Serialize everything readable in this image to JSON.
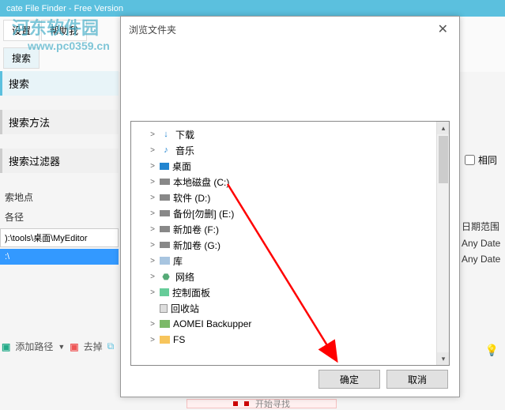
{
  "app": {
    "title": "cate File Finder - Free Version"
  },
  "toolbar": {
    "settings": "设置",
    "help": "帮助我",
    "search": "搜索"
  },
  "watermark": {
    "line1": "河东软件园",
    "line2": "www.pc0359.cn"
  },
  "sections": {
    "search": "搜索",
    "method": "搜索方法",
    "filter": "搜索过滤器",
    "location": "索地点",
    "path_label": "各径"
  },
  "paths": {
    "p1": "):\\tools\\桌面\\MyEditor",
    "p2": ":\\"
  },
  "bottom_tools": {
    "add": "添加路径",
    "remove": "去掉"
  },
  "right": {
    "same_check": "相同",
    "date_range": "日期范围",
    "any1": "Any Date",
    "any2": "Any Date"
  },
  "dialog": {
    "title": "浏览文件夹",
    "ok": "确定",
    "cancel": "取消",
    "tree": [
      {
        "exp": ">",
        "icon": "arrow-blue",
        "glyph": "↓",
        "label": "下载"
      },
      {
        "exp": ">",
        "icon": "note-blue",
        "glyph": "♪",
        "label": "音乐"
      },
      {
        "exp": ">",
        "icon": "screen-blue",
        "glyph": "",
        "label": "桌面"
      },
      {
        "exp": ">",
        "icon": "disk",
        "glyph": "",
        "label": "本地磁盘 (C:)"
      },
      {
        "exp": ">",
        "icon": "disk",
        "glyph": "",
        "label": "软件 (D:)"
      },
      {
        "exp": ">",
        "icon": "disk",
        "glyph": "",
        "label": "备份[勿删] (E:)"
      },
      {
        "exp": ">",
        "icon": "disk",
        "glyph": "",
        "label": "新加卷 (F:)"
      },
      {
        "exp": ">",
        "icon": "disk",
        "glyph": "",
        "label": "新加卷 (G:)"
      },
      {
        "exp": ">",
        "icon": "lib",
        "glyph": "",
        "label": "库"
      },
      {
        "exp": ">",
        "icon": "net",
        "glyph": "⬣",
        "label": "网络"
      },
      {
        "exp": ">",
        "icon": "ctrl",
        "glyph": "",
        "label": "控制面板"
      },
      {
        "exp": "",
        "icon": "trash",
        "glyph": "",
        "label": "回收站"
      },
      {
        "exp": ">",
        "icon": "folder-grn",
        "glyph": "",
        "label": "AOMEI Backupper"
      },
      {
        "exp": ">",
        "icon": "folder",
        "glyph": "",
        "label": "FS"
      }
    ]
  },
  "start_bar": "开始寻找"
}
